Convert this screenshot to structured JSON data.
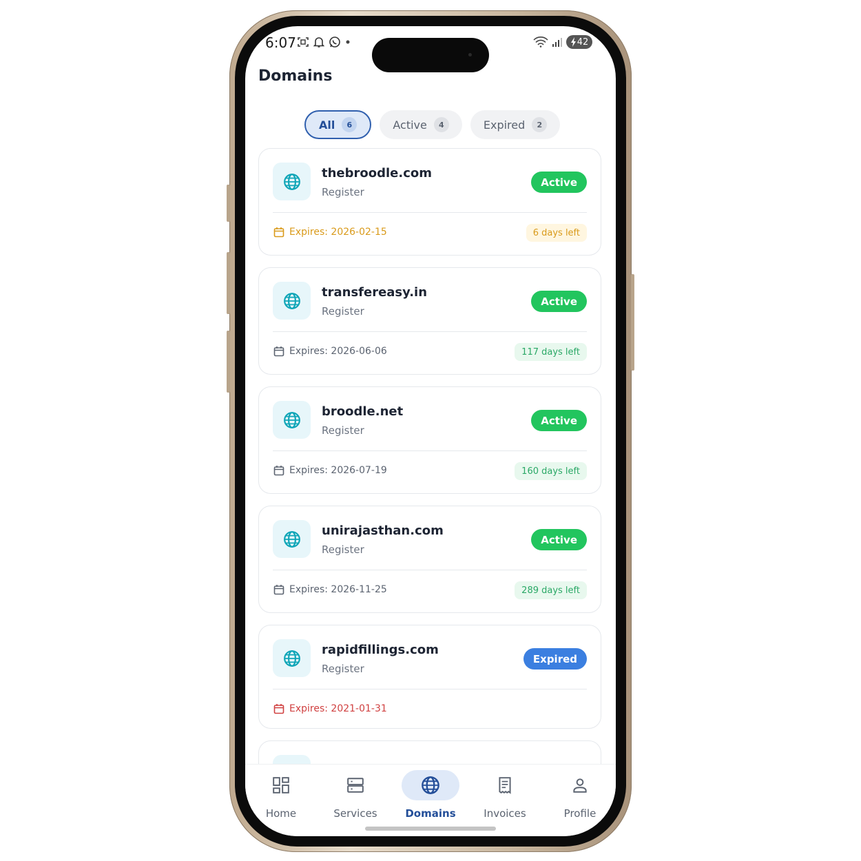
{
  "status_bar": {
    "time": "6:07",
    "battery": "42"
  },
  "page": {
    "title": "Domains"
  },
  "tabs": [
    {
      "label": "All",
      "count": "6",
      "selected": true
    },
    {
      "label": "Active",
      "count": "4",
      "selected": false
    },
    {
      "label": "Expired",
      "count": "2",
      "selected": false
    }
  ],
  "domains": [
    {
      "name": "thebroodle.com",
      "type": "Register",
      "status": "Active",
      "expires": "Expires: 2026-02-15",
      "days_left": "6 days left"
    },
    {
      "name": "transfereasy.in",
      "type": "Register",
      "status": "Active",
      "expires": "Expires: 2026-06-06",
      "days_left": "117 days left"
    },
    {
      "name": "broodle.net",
      "type": "Register",
      "status": "Active",
      "expires": "Expires: 2026-07-19",
      "days_left": "160 days left"
    },
    {
      "name": "unirajasthan.com",
      "type": "Register",
      "status": "Active",
      "expires": "Expires: 2026-11-25",
      "days_left": "289 days left"
    },
    {
      "name": "rapidfillings.com",
      "type": "Register",
      "status": "Expired",
      "expires": "Expires: 2021-01-31",
      "days_left": ""
    }
  ],
  "bottom_nav": [
    {
      "label": "Home",
      "icon": "grid-icon"
    },
    {
      "label": "Services",
      "icon": "server-icon"
    },
    {
      "label": "Domains",
      "icon": "globe-icon",
      "selected": true
    },
    {
      "label": "Invoices",
      "icon": "receipt-icon"
    },
    {
      "label": "Profile",
      "icon": "user-icon"
    }
  ],
  "colors": {
    "accent": "#244f99",
    "active_badge": "#22c55e",
    "expired_badge": "#3b7fe0",
    "warning": "#d99a1a",
    "danger": "#d04040",
    "muted": "#5b6370"
  }
}
